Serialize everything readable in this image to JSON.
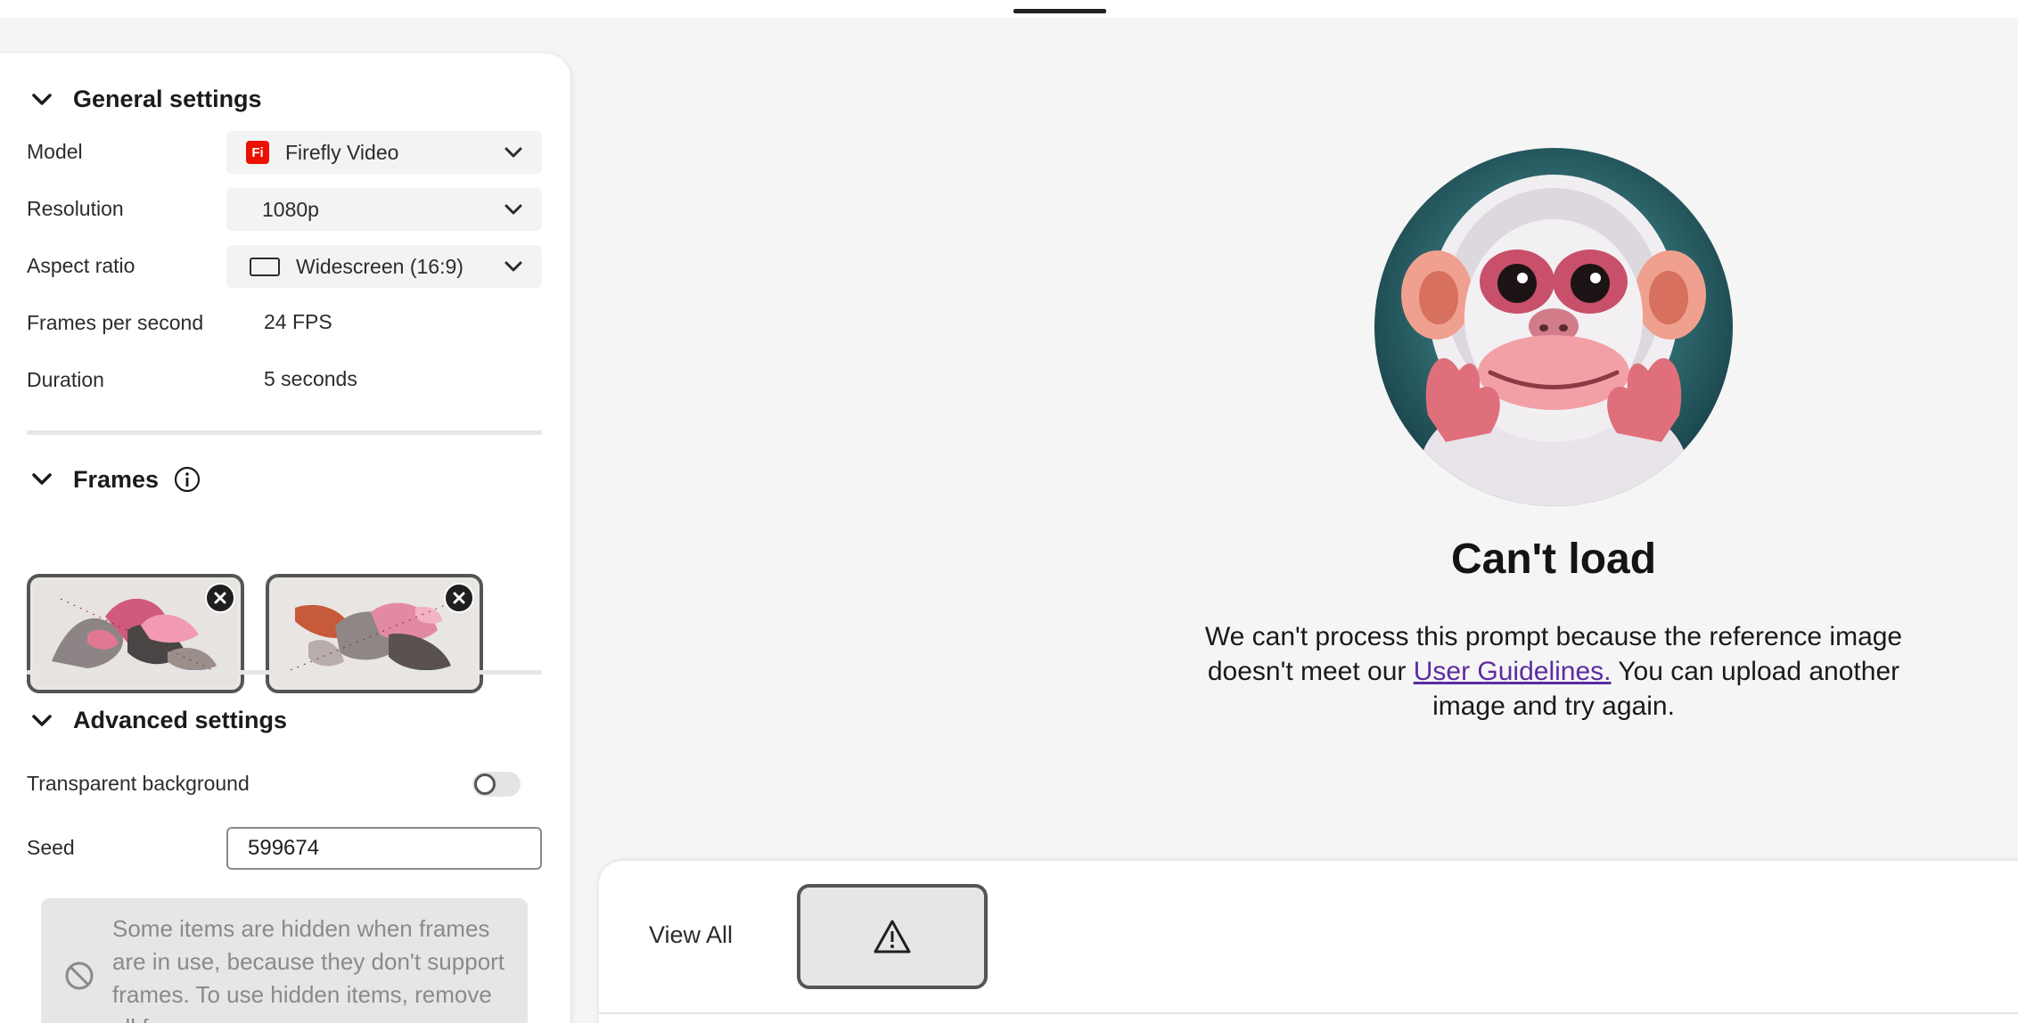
{
  "general": {
    "title": "General settings",
    "model": {
      "label": "Model",
      "value": "Firefly Video",
      "badge": "Fi"
    },
    "resolution": {
      "label": "Resolution",
      "value": "1080p"
    },
    "aspect_ratio": {
      "label": "Aspect ratio",
      "value": "Widescreen (16:9)"
    },
    "fps": {
      "label": "Frames per second",
      "value": "24 FPS"
    },
    "duration": {
      "label": "Duration",
      "value": "5 seconds"
    }
  },
  "frames": {
    "title": "Frames"
  },
  "advanced": {
    "title": "Advanced settings",
    "transparent_bg": {
      "label": "Transparent background",
      "enabled": false
    },
    "seed": {
      "label": "Seed",
      "value": "599674"
    },
    "notice": "Some items are hidden when frames are in use, because they don't support frames. To use hidden items, remove all frames."
  },
  "main": {
    "title": "Can't load",
    "message_before": "We can't process this prompt because the reference image doesn't meet our ",
    "link": "User Guidelines.",
    "message_after": " You can upload another image and try again."
  },
  "bottom": {
    "view_all": "View All"
  },
  "colors": {
    "brand_red": "#eb1000",
    "link": "#5c2ca0"
  }
}
